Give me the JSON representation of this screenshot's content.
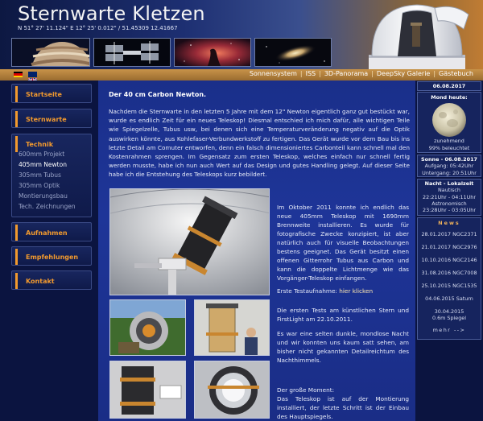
{
  "header": {
    "title": "Sternwarte Kletzen",
    "coords": "N 51° 27' 11.124\" E 12° 25' 0.012\" / 51.45309 12.41667"
  },
  "topnav": {
    "items": [
      "Sonnensystem",
      "ISS",
      "3D-Panorama",
      "DeepSky Galerie",
      "Gästebuch"
    ],
    "separator": "|"
  },
  "sidebar": {
    "sections": [
      {
        "label": "Startseite"
      },
      {
        "label": "Sternwarte"
      },
      {
        "label": "Technik"
      },
      {
        "label": "Aufnahmen"
      },
      {
        "label": "Empfehlungen"
      },
      {
        "label": "Kontakt"
      }
    ],
    "technik_sub": [
      "600mm Projekt",
      "405mm Newton",
      "305mm Tubus",
      "305mm Optik",
      "Montierungsbau",
      "Tech. Zeichnungen"
    ]
  },
  "article": {
    "title": "Der 40 cm Carbon Newton.",
    "intro": "Nachdem die Sternwarte in den letzten 5 Jahre mit dem 12\" Newton eigentlich ganz gut bestückt war, wurde es endlich Zeit für ein neues Teleskop! Diesmal entschied ich mich dafür, alle wichtigen Teile wie Spiegelzelle, Tubus usw, bei denen sich eine Temperaturveränderung negativ auf die Optik auswirken könnte, aus Kohlefaser-Verbundwerkstoff zu fertigen. Das Gerät wurde vor dem Bau bis ins letzte Detail am Comuter entworfen, denn ein falsch dimensioniertes Carbonteil kann schnell mal den Kostenrahmen sprengen. Im Gegensatz zum ersten Teleskop, welches einfach nur schnell fertig werden musste, habe ich nun auch Wert auf das Design und gutes Handling gelegt. Auf dieser Seite habe ich die Entstehung des Teleskops kurz bebildert.",
    "para1": "Im Oktober 2011 konnte ich endlich das neue 405mm Teleskop mit 1690mm Brennweite installieren. Es wurde für fotografische Zwecke konzipiert, ist aber natürlich auch für visuelle Beobachtungen bestens geeignet. Das Gerät besitzt einen offenen Gitterrohr Tubus aus Carbon und kann die doppelte Lichtmenge wie das Vorgänger-Teleskop einfangen.",
    "first_light_prefix": "Erste Testaufnahme:",
    "first_light_link": "hier klicken",
    "para2": "Die ersten Tests am künstlichen Stern und FirstLight am 22.10.2011.",
    "para3": "Es war eine selten dunkle, mondlose Nacht und wir konnten uns kaum satt sehen, am bisher nicht gekannten Detailreichtum des Nachthimmels.",
    "para4_title": "Der große Moment:",
    "para4": "Das Teleskop ist auf der Montierung installiert, der letzte Schritt ist der Einbau des Hauptspiegels."
  },
  "rightbar": {
    "date": "06.08.2017",
    "moon_title": "Mond heute:",
    "moon_phase": "zunehmend",
    "moon_illum": "99% beleuchtet",
    "sun_title": "Sonne - 06.08.2017",
    "sun_rise": "Aufgang: 05:42Uhr",
    "sun_set": "Untergang: 20:51Uhr",
    "night_title": "Nacht - Lokalzeit",
    "night_naut_label": "Nautisch",
    "night_naut": "22:21Uhr - 04:11Uhr",
    "night_astro_label": "Astronomisch",
    "night_astro": "23:28Uhr - 03:05Uhr",
    "news_title": "News",
    "news": [
      "28.01.2017 NGC2371",
      "21.01.2017 NGC2976",
      "10.10.2016 NGC2146",
      "31.08.2016 NGC7008",
      "25.10.2015 NGC1535",
      "04.06.2015 Saturn",
      "30.04.2015",
      "0.6m Spiegel",
      "mehr -->"
    ]
  },
  "colors": {
    "accent": "#f29a2e",
    "nav_bar": "#b5823e",
    "main_bg": "#1c3392",
    "page_bg": "#0a1235"
  }
}
